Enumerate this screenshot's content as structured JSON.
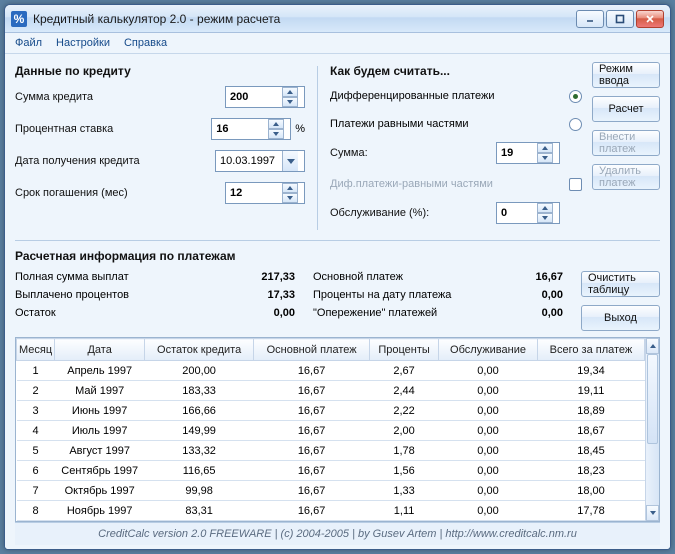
{
  "window": {
    "title": "Кредитный калькулятор 2.0 - режим расчета",
    "appicon": "%"
  },
  "menu": {
    "file": "Файл",
    "settings": "Настройки",
    "help": "Справка"
  },
  "left": {
    "heading": "Данные по кредиту",
    "amount_label": "Сумма кредита",
    "amount": "200",
    "rate_label": "Процентная ставка",
    "rate": "16",
    "pct": "%",
    "date_label": "Дата получения кредита",
    "date": "10.03.1997",
    "term_label": "Срок погашения (мес)",
    "term": "12"
  },
  "mid": {
    "heading": "Как будем считать...",
    "diff_label": "Дифференцированные платежи",
    "equal_label": "Платежи равными частями",
    "sum_label": "Сумма:",
    "sum": "19",
    "diffeq_label": "Диф.платежи-равными частями",
    "service_label": "Обслуживание (%):",
    "service": "0"
  },
  "buttons": {
    "mode": "Режим ввода",
    "calc": "Расчет",
    "add_payment": "Внести платеж",
    "del_payment": "Удалить платеж",
    "clear_table": "Очистить таблицу",
    "exit": "Выход"
  },
  "calc": {
    "heading": "Расчетная информация по платежам",
    "total_label": "Полная сумма выплат",
    "total": "217,33",
    "interest_label": "Выплачено процентов",
    "interest": "17,33",
    "remainder_label": "Остаток",
    "remainder": "0,00",
    "principal_label": "Основной платеж",
    "principal": "16,67",
    "date_interest_label": "Проценты на дату платежа",
    "date_interest": "0,00",
    "advance_label": "\"Опережение\" платежей",
    "advance": "0,00"
  },
  "grid": {
    "headers": {
      "month": "Месяц",
      "date": "Дата",
      "balance": "Остаток кредита",
      "principal": "Основной платеж",
      "interest": "Проценты",
      "service": "Обслуживание",
      "total": "Всего за платеж"
    },
    "rows": [
      {
        "m": "1",
        "d": "Апрель 1997",
        "b": "200,00",
        "p": "16,67",
        "i": "2,67",
        "s": "0,00",
        "t": "19,34"
      },
      {
        "m": "2",
        "d": "Май 1997",
        "b": "183,33",
        "p": "16,67",
        "i": "2,44",
        "s": "0,00",
        "t": "19,11"
      },
      {
        "m": "3",
        "d": "Июнь 1997",
        "b": "166,66",
        "p": "16,67",
        "i": "2,22",
        "s": "0,00",
        "t": "18,89"
      },
      {
        "m": "4",
        "d": "Июль 1997",
        "b": "149,99",
        "p": "16,67",
        "i": "2,00",
        "s": "0,00",
        "t": "18,67"
      },
      {
        "m": "5",
        "d": "Август 1997",
        "b": "133,32",
        "p": "16,67",
        "i": "1,78",
        "s": "0,00",
        "t": "18,45"
      },
      {
        "m": "6",
        "d": "Сентябрь 1997",
        "b": "116,65",
        "p": "16,67",
        "i": "1,56",
        "s": "0,00",
        "t": "18,23"
      },
      {
        "m": "7",
        "d": "Октябрь 1997",
        "b": "99,98",
        "p": "16,67",
        "i": "1,33",
        "s": "0,00",
        "t": "18,00"
      },
      {
        "m": "8",
        "d": "Ноябрь 1997",
        "b": "83,31",
        "p": "16,67",
        "i": "1,11",
        "s": "0,00",
        "t": "17,78"
      }
    ]
  },
  "status": "CreditCalc version 2.0  FREEWARE   |   (c) 2004-2005   |   by Gusev Artem   |   http://www.creditcalc.nm.ru"
}
